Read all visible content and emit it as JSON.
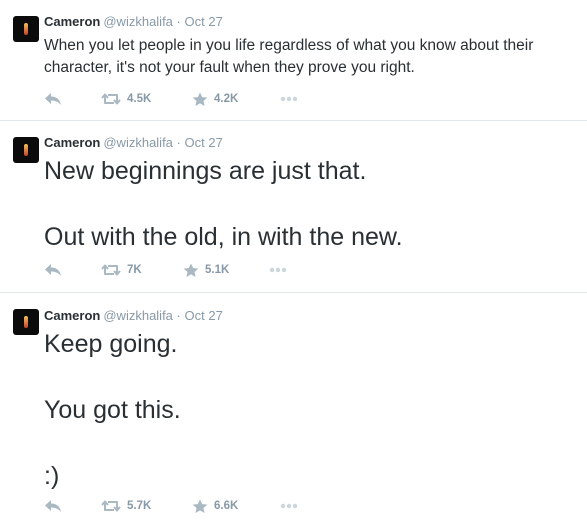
{
  "tweets": [
    {
      "name": "Cameron",
      "handle": "@wizkhalifa",
      "separator": "·",
      "date": "Oct 27",
      "text": "When you let people in you life regardless of what you know about their character, it's not your fault when they prove you right.",
      "retweets": "4.5K",
      "favorites": "4.2K"
    },
    {
      "name": "Cameron",
      "handle": "@wizkhalifa",
      "separator": "·",
      "date": "Oct 27",
      "text": "New beginnings are just that.\n\nOut with the old, in with the new.",
      "retweets": "7K",
      "favorites": "5.1K"
    },
    {
      "name": "Cameron",
      "handle": "@wizkhalifa",
      "separator": "·",
      "date": "Oct 27",
      "text": "Keep going.\n\nYou got this.\n\n:)",
      "retweets": "5.7K",
      "favorites": "6.6K"
    }
  ],
  "icons": {
    "reply": "reply-icon",
    "retweet": "retweet-icon",
    "favorite": "star-icon",
    "more": "more-icon"
  },
  "colors": {
    "text": "#292f33",
    "muted": "#8899a6",
    "icon": "#aab8c2",
    "divider": "#e1e8ed"
  }
}
